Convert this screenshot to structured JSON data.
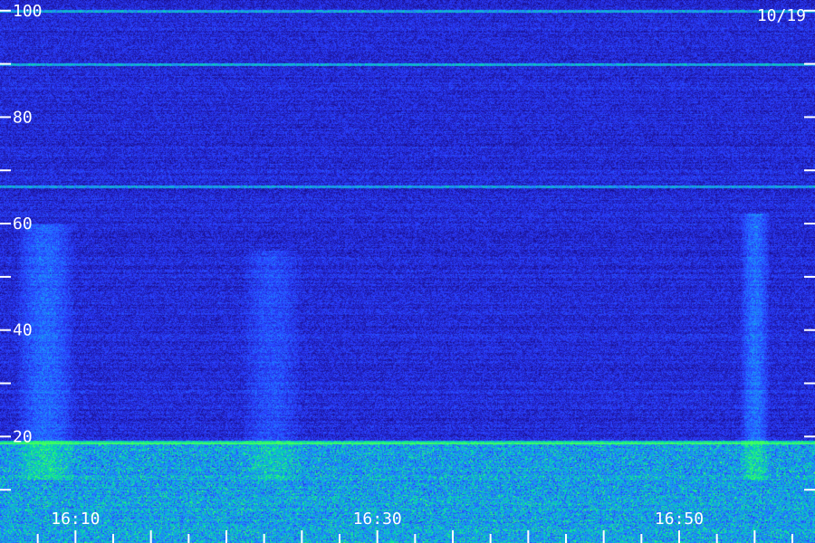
{
  "chart_data": {
    "type": "heatmap",
    "date_label": "10/19",
    "x_axis": {
      "range": [
        "16:05",
        "16:59"
      ],
      "major_tick_labels": [
        "16:10",
        "16:30",
        "16:50"
      ],
      "minor_tick_interval_minutes": 2.5
    },
    "y_axis": {
      "range": [
        0,
        102
      ],
      "tick_values": [
        10,
        20,
        30,
        40,
        50,
        60,
        70,
        80,
        90,
        100
      ],
      "tick_labels": [
        "20",
        "40",
        "60",
        "80",
        "100"
      ]
    },
    "colormap": [
      "#0a0430",
      "#1a0e8a",
      "#2a3cff",
      "#1e90ff",
      "#00e0a0",
      "#40ff60"
    ],
    "features": {
      "horizontal_lines_y": [
        100,
        90,
        67
      ],
      "low_band_y_range": [
        0,
        19
      ],
      "bursts": [
        {
          "time_range": [
            "16:06",
            "16:10"
          ],
          "y_range": [
            12,
            60
          ],
          "intensity": 0.55
        },
        {
          "time_range": [
            "16:21",
            "16:25"
          ],
          "y_range": [
            12,
            55
          ],
          "intensity": 0.35
        },
        {
          "time_range": [
            "16:54",
            "16:56"
          ],
          "y_range": [
            12,
            62
          ],
          "intensity": 0.6
        }
      ]
    }
  }
}
